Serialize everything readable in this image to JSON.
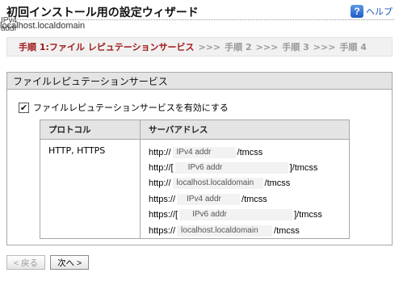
{
  "header": {
    "title": "初回インストール用の設定ウィザード",
    "overlay_ipv4": "IPv4 addr",
    "overlay_host": "localhost.localdomain",
    "help_label": "ヘルプ",
    "help_icon": "question-icon"
  },
  "steps": {
    "current": "手順 1:ファイル レピュテーションサービス",
    "separator": ">>>",
    "step2": "手順 2",
    "step3": "手順 3",
    "step4": "手順 4"
  },
  "section": {
    "title": "ファイルレピュテーションサービス",
    "enable_label": "ファイルレピュテーションサービスを有効にする",
    "enable_checked": true,
    "table": {
      "headers": [
        "プロトコル",
        "サーバアドレス"
      ],
      "protocol": "HTTP, HTTPS",
      "addresses": [
        {
          "prefix": "http://",
          "field": "IPv4 addr",
          "suffix": "/tmcss"
        },
        {
          "prefix": "http://[",
          "field": "IPv6 addr",
          "suffix": "]/tmcss"
        },
        {
          "prefix": "http://",
          "field": "localhost.localdomain",
          "suffix": "/tmcss"
        },
        {
          "prefix": "https://",
          "field": "IPv4 addr",
          "suffix": "/tmcss"
        },
        {
          "prefix": "https://[",
          "field": "IPv6 addr",
          "suffix": "]/tmcss"
        },
        {
          "prefix": "https://",
          "field": "localhost.localdomain",
          "suffix": "/tmcss"
        }
      ]
    }
  },
  "buttons": {
    "back": "< 戻る",
    "next": "次へ >"
  },
  "colors": {
    "current_step": "#a01919",
    "inactive_step": "#9a9a9a",
    "header_bg": "#e4e4e4",
    "help_link": "#1a56b5"
  }
}
